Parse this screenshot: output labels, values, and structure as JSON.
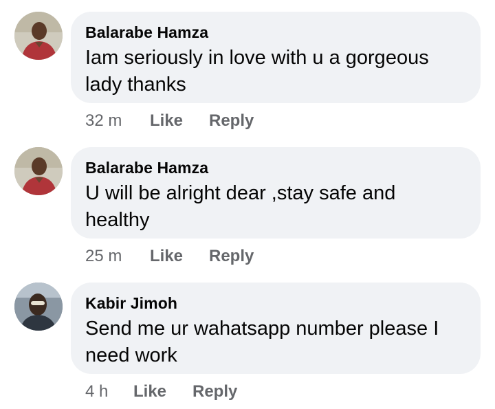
{
  "comments": [
    {
      "author": "Balarabe Hamza",
      "text_line1": "Iam seriously in love with u a gorgeous",
      "text_line2": "lady thanks",
      "time": "32 m",
      "like_label": "Like",
      "reply_label": "Reply",
      "avatar_icon": "profile-photo-icon"
    },
    {
      "author": "Balarabe Hamza",
      "text_line1": "U will be alright dear ,stay safe and",
      "text_line2": "healthy",
      "time": "25 m",
      "like_label": "Like",
      "reply_label": "Reply",
      "avatar_icon": "profile-photo-icon"
    },
    {
      "author": "Kabir Jimoh",
      "text_line1": "Send me ur wahatsapp number please I",
      "text_line2": "need work",
      "time": "4 h",
      "like_label": "Like",
      "reply_label": "Reply",
      "avatar_icon": "profile-photo-icon"
    }
  ],
  "colors": {
    "bubble_bg": "#f0f2f5",
    "text": "#050505",
    "meta": "#65676b"
  }
}
